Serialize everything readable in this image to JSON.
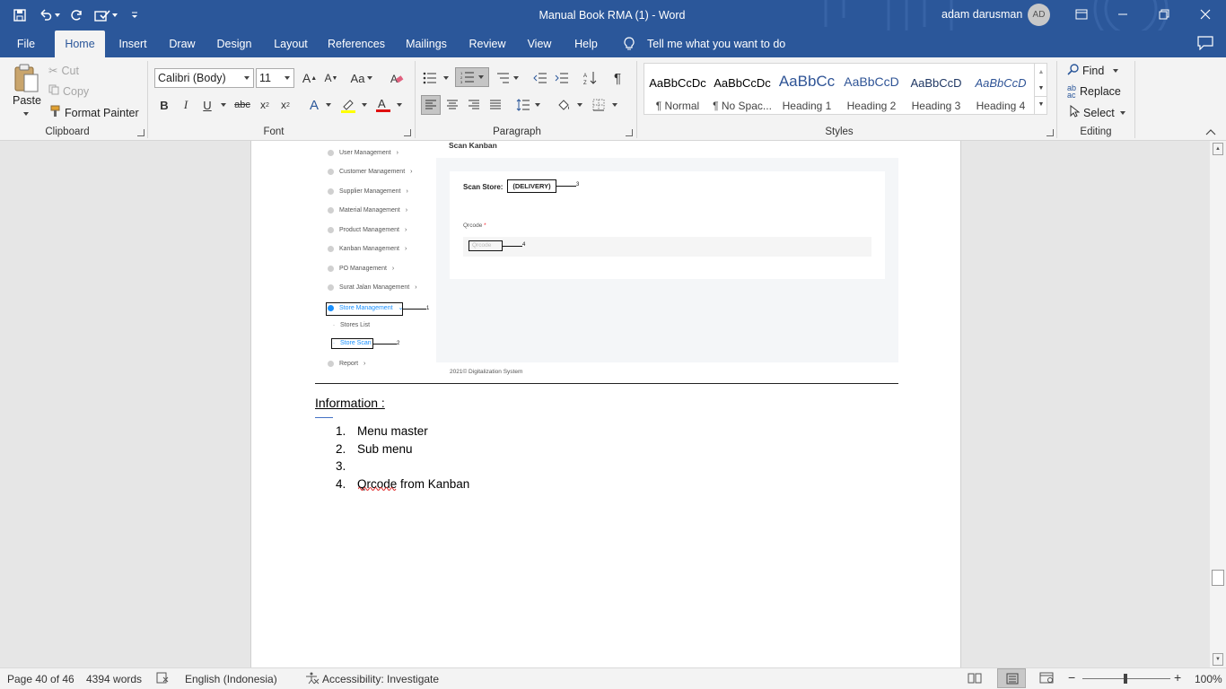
{
  "title_bar": {
    "doc_title": "Manual Book RMA (1)  -  Word",
    "user_name": "adam darusman",
    "avatar_initials": "AD"
  },
  "tabs": [
    "File",
    "Home",
    "Insert",
    "Draw",
    "Design",
    "Layout",
    "References",
    "Mailings",
    "Review",
    "View",
    "Help"
  ],
  "active_tab": "Home",
  "tell_me": "Tell me what you want to do",
  "ribbon": {
    "clipboard": {
      "paste": "Paste",
      "cut": "Cut",
      "copy": "Copy",
      "format_painter": "Format Painter",
      "label": "Clipboard"
    },
    "font": {
      "name": "Calibri (Body)",
      "size": "11",
      "label": "Font"
    },
    "paragraph": {
      "label": "Paragraph"
    },
    "styles": {
      "label": "Styles",
      "items": [
        {
          "sample": "AaBbCcDc",
          "name": "¶ Normal"
        },
        {
          "sample": "AaBbCcDc",
          "name": "¶ No Spac..."
        },
        {
          "sample": "AaBbCc",
          "name": "Heading 1"
        },
        {
          "sample": "AaBbCcD",
          "name": "Heading 2"
        },
        {
          "sample": "AaBbCcD",
          "name": "Heading 3"
        },
        {
          "sample": "AaBbCcD",
          "name": "Heading 4"
        }
      ]
    },
    "editing": {
      "find": "Find",
      "replace": "Replace",
      "select": "Select",
      "label": "Editing"
    }
  },
  "document": {
    "screenshot": {
      "page_title": "Scan Kanban",
      "menu": [
        "User Management",
        "Customer Management",
        "Supplier Management",
        "Material Management",
        "Product Management",
        "Kanban Management",
        "PO Management",
        "Surat Jalan Management",
        "Store Management",
        "Stores List",
        "Store Scan",
        "Report"
      ],
      "scan_store_label": "Scan Store:",
      "scan_store_value": "(DELIVERY)",
      "qrcode_label": "Qrcode",
      "qrcode_required": "*",
      "qrcode_placeholder": "Qrcode",
      "footer": "2021© Digitalization System",
      "annotations": [
        "1",
        "2",
        "3",
        "4"
      ]
    },
    "info_heading": "Information :",
    "list": [
      {
        "num": "1.",
        "text": "Menu master"
      },
      {
        "num": "2.",
        "text": "Sub menu"
      },
      {
        "num": "3.",
        "text": ""
      },
      {
        "num": "4.",
        "text": "Qrcode from Kanban"
      }
    ]
  },
  "status_bar": {
    "page": "Page 40 of 46",
    "words": "4394 words",
    "language": "English (Indonesia)",
    "accessibility": "Accessibility: Investigate",
    "zoom": "100%"
  },
  "colors": {
    "accent": "#2b579a",
    "ribbon_bg": "#f3f3f3",
    "link": "#1890ff"
  }
}
